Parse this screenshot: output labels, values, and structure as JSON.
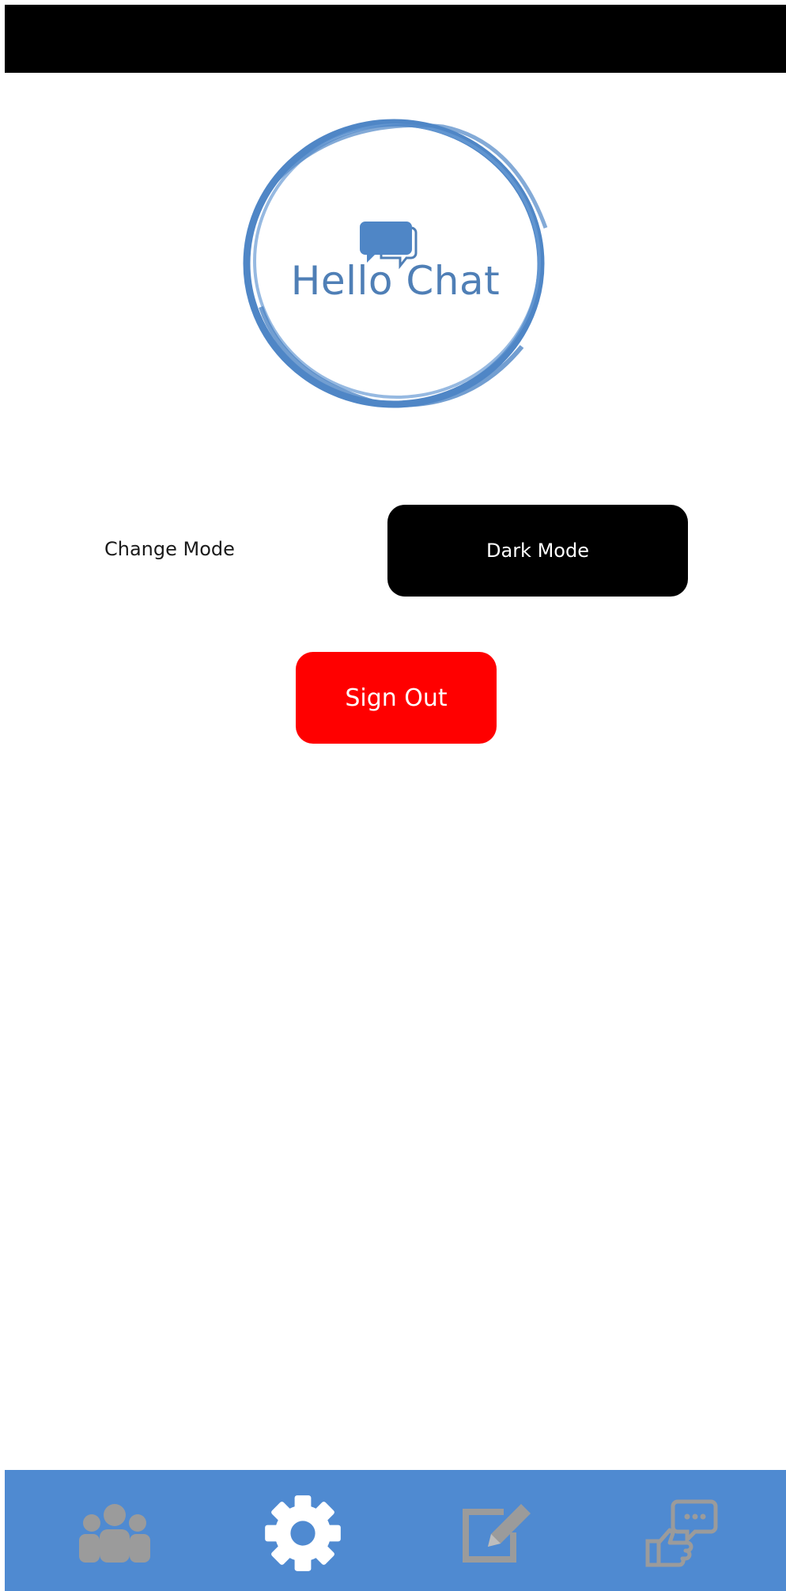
{
  "app": {
    "logo_title": "Hello Chat"
  },
  "settings": {
    "change_mode_label": "Change Mode",
    "dark_mode_button": "Dark Mode",
    "sign_out_button": "Sign Out"
  },
  "nav": {
    "items": [
      {
        "icon": "people-icon",
        "active": false
      },
      {
        "icon": "gear-icon",
        "active": true
      },
      {
        "icon": "edit-icon",
        "active": false
      },
      {
        "icon": "feedback-icon",
        "active": false
      }
    ]
  },
  "colors": {
    "accent": "#4f8ad1",
    "logo_blue": "#4f7fb6",
    "sign_out": "#ff0000",
    "dark_button": "#000000",
    "nav_inactive": "#9b9b9b",
    "nav_active": "#ffffff"
  }
}
